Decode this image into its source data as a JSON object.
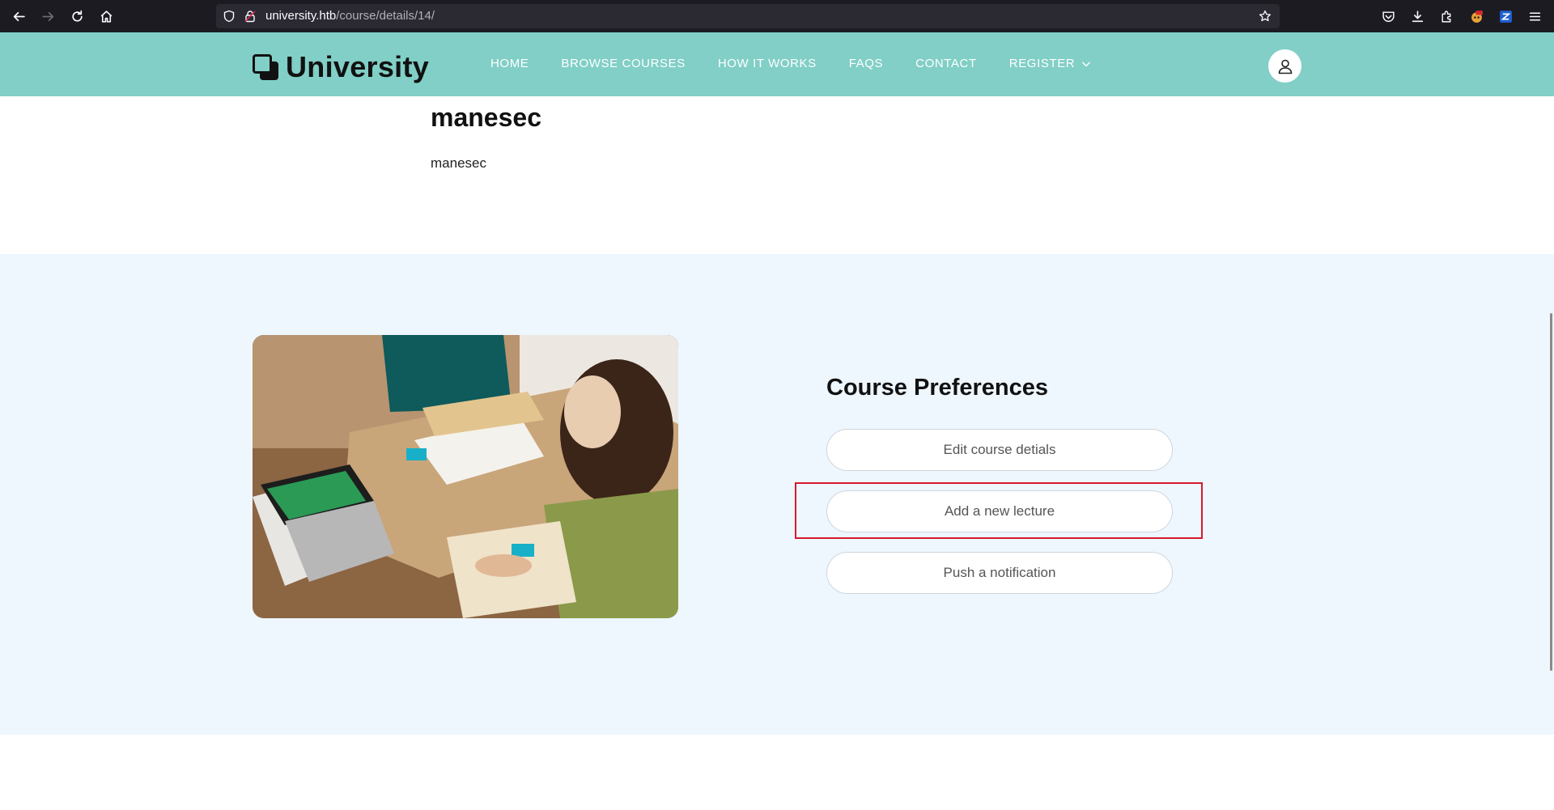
{
  "browser": {
    "url_host": "university.htb",
    "url_path": "/course/details/14/"
  },
  "site": {
    "logo_text": "University",
    "nav": {
      "home": "HOME",
      "browse": "BROWSE COURSES",
      "how": "HOW IT WORKS",
      "faqs": "FAQS",
      "contact": "CONTACT",
      "register": "REGISTER"
    }
  },
  "course": {
    "title": "manesec",
    "description": "manesec"
  },
  "preferences": {
    "title": "Course Preferences",
    "edit_label": "Edit course detials",
    "add_lecture_label": "Add a new lecture",
    "push_notification_label": "Push a notification"
  },
  "colors": {
    "header_bg": "#81cfc6",
    "section_bg": "#eef6fe",
    "highlight": "#d7192e",
    "browser_bg": "#1c1b22"
  },
  "icons": [
    "back-arrow-icon",
    "forward-arrow-icon",
    "reload-icon",
    "home-icon",
    "shield-icon",
    "lock-icon",
    "bookmark-star-icon",
    "pocket-icon",
    "download-icon",
    "extensions-icon",
    "menu-icon",
    "user-icon",
    "chevron-down-icon"
  ]
}
